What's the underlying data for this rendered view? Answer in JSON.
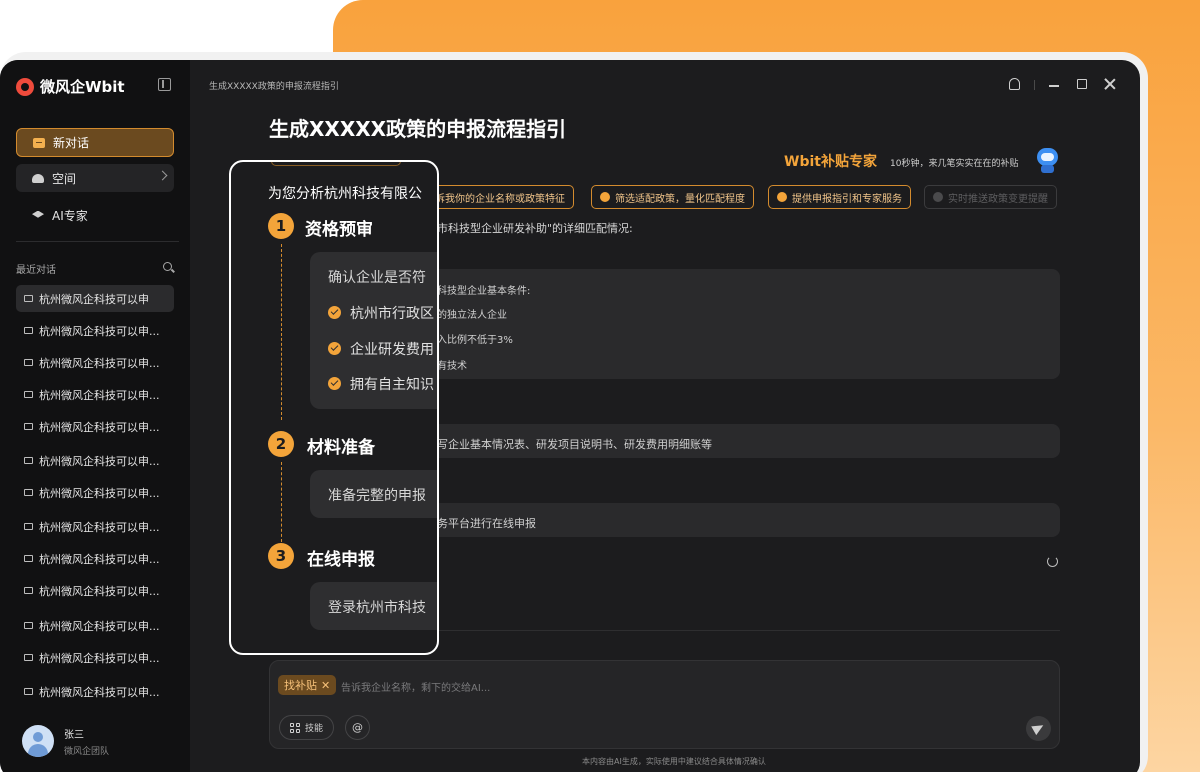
{
  "app": {
    "name": "微风企Wbit"
  },
  "sidebar": {
    "nav": [
      {
        "label": "新对话",
        "icon": "new-chat-icon"
      },
      {
        "label": "空间",
        "icon": "space-icon"
      },
      {
        "label": "AI专家",
        "icon": "graduation-cap-icon"
      }
    ],
    "recent_title": "最近对话",
    "recent": [
      "杭州微风企科技可以申",
      "杭州微风企科技可以申...",
      "杭州微风企科技可以申...",
      "杭州微风企科技可以申...",
      "杭州微风企科技可以申...",
      "杭州微风企科技可以申...",
      "杭州微风企科技可以申...",
      "杭州微风企科技可以申...",
      "杭州微风企科技可以申...",
      "杭州微风企科技可以申...",
      "杭州微风企科技可以申...",
      "杭州微风企科技可以申...",
      "杭州微风企科技可以申..."
    ],
    "user": {
      "name": "张三",
      "team": "微风企团队"
    }
  },
  "header": {
    "breadcrumb": "生成XXXXX政策的申报流程指引"
  },
  "main": {
    "title": "生成XXXXX政策的申报流程指引",
    "expert_title": "Wbit补贴专家",
    "expert_subtitle": "10秒钟，来几笔实实在在的补贴",
    "chips": [
      "诉我你的企业名称或政策特征",
      "筛选适配政策，量化匹配程度",
      "提供申报指引和专家服务",
      "实时推送政策变更提醒"
    ],
    "match_text": "市科技型企业研发补助\"的详细匹配情况:",
    "conditions_title": "科技型企业基本条件:",
    "conditions": [
      "的独立法人企业",
      "入比例不低于3%",
      "有技术"
    ],
    "materials_text": "写企业基本情况表、研发项目说明书、研发费用明细账等",
    "online_text": "务平台进行在线申报",
    "composer": {
      "tag": "找补贴",
      "placeholder": "告诉我企业名称，剩下的交给AI...",
      "skill_label": "技能",
      "at_label": "@"
    },
    "footer_note": "本内容由AI生成，实际使用中建议结合具体情况确认"
  },
  "zoom": {
    "intro": "为您分析杭州科技有限公",
    "steps": [
      {
        "num": "1",
        "title": "资格预审"
      },
      {
        "num": "2",
        "title": "材料准备"
      },
      {
        "num": "3",
        "title": "在线申报"
      }
    ],
    "qualify_box": "确认企业是否符",
    "checks": [
      "杭州市行政区",
      "企业研发费用",
      "拥有自主知识"
    ],
    "materials_box": "准备完整的申报",
    "online_box": "登录杭州市科技"
  },
  "colors": {
    "accent": "#f3a43a",
    "background": "#1c1c1e",
    "sidebar": "#111112"
  }
}
